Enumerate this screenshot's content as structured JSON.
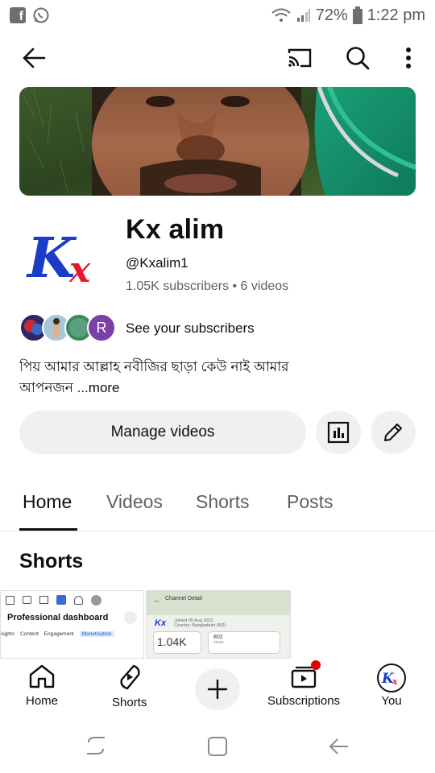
{
  "status_bar": {
    "battery": "72%",
    "time": "1:22 pm"
  },
  "channel": {
    "name": "Kx alim",
    "handle": "@Kxalim1",
    "meta": "1.05K subscribers • 6 videos",
    "see_subscribers": "See your subscribers",
    "description_line1": "পিয় আমার আল্লাহ নবীজির ছাড়া কেউ নাই আমার",
    "description_line2": "আপনজন",
    "more": "...more",
    "avatar_letters": "Kx",
    "mini_avatar_letter": "R",
    "manage_videos": "Manage videos"
  },
  "tabs": [
    {
      "label": "Home"
    },
    {
      "label": "Videos"
    },
    {
      "label": "Shorts"
    },
    {
      "label": "Posts"
    }
  ],
  "section": {
    "title": "Shorts"
  },
  "thumb1": {
    "title": "Professional dashboard",
    "tab1": "sights",
    "tab2": "Content",
    "tab3": "Engagement",
    "tab4": "Monetisation"
  },
  "thumb2": {
    "header": "Channel Detail",
    "big_number": "1.04K",
    "views_num": "802",
    "views_label": "views",
    "joined": "Joined 05 Aug 2022",
    "country": "Country: Bangladesh (BD)"
  },
  "bottom_nav": [
    {
      "label": "Home"
    },
    {
      "label": "Shorts"
    },
    {
      "label": ""
    },
    {
      "label": "Subscriptions"
    },
    {
      "label": "You"
    }
  ],
  "colors": {
    "brand_red": "#ff0000",
    "notif_dot": "#e00000",
    "logo_blue": "#1a3cc9",
    "logo_red": "#e8182b",
    "chip_bg": "#f0f0f0",
    "mini_avatar_purple": "#7b3fa6"
  },
  "icons": {
    "back": "arrow-left-icon",
    "cast": "cast-icon",
    "search": "search-icon",
    "more": "more-vert-icon",
    "analytics": "bar-chart-icon",
    "edit": "pencil-icon"
  }
}
